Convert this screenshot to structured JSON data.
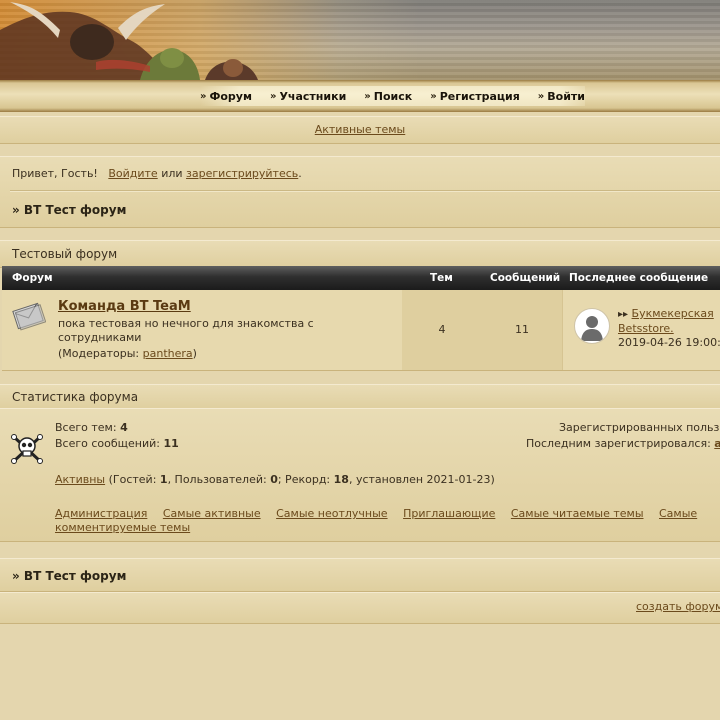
{
  "nav": {
    "items": [
      {
        "label": "Форум",
        "icon": "double-chevron-icon"
      },
      {
        "label": "Участники",
        "icon": "double-chevron-icon"
      },
      {
        "label": "Поиск",
        "icon": "double-chevron-icon"
      },
      {
        "label": "Регистрация",
        "icon": "double-chevron-icon"
      },
      {
        "label": "Войти",
        "icon": "double-chevron-icon"
      }
    ]
  },
  "active_topics_link": "Активные темы",
  "greeting": {
    "prefix": "Привет, Гость!",
    "login_link": "Войдите",
    "middle": "или",
    "register_link": "зарегистрируйтесь",
    "suffix": "."
  },
  "breadcrumb": "» BT Тест форум",
  "category": {
    "title": "Тестовый форум",
    "columns": {
      "forum": "Форум",
      "topics": "Тем",
      "posts": "Сообщений",
      "last_post": "Последнее сообщение"
    },
    "forums": [
      {
        "name": "Команда BT TeaM",
        "description": "пока тестовая но нечного для знакомства с сотрудниками",
        "moderators_prefix": "(Модераторы:",
        "moderator": "panthera",
        "moderators_suffix": ")",
        "topics": "4",
        "posts": "11",
        "last_post_title": "Букмекерская",
        "last_post_title_cont": "Betsstore.",
        "last_post_date": "2019-04-26 19:00:"
      }
    ]
  },
  "stats": {
    "title": "Статистика форума",
    "total_topics_label": "Всего тем:",
    "total_topics": "4",
    "total_posts_label": "Всего сообщений:",
    "total_posts": "11",
    "registered_label": "Зарегистрированных польз",
    "last_registered_label": "Последним зарегистрировался:",
    "last_registered_user": "a",
    "online_link": "Активны",
    "guests_label": "(Гостей:",
    "guests": "1",
    "users_label": ", Пользователей:",
    "users": "0",
    "record_label": "; Рекорд:",
    "record": "18",
    "record_date": ", установлен 2021-01-23)",
    "links": [
      "Администрация",
      "Самые активные",
      "Самые неотлучные",
      "Приглашающие",
      "Самые читаемые темы",
      "Самые комментируемые темы"
    ]
  },
  "footer": {
    "breadcrumb": "» BT Тест форум",
    "create_link": "создать форум"
  }
}
